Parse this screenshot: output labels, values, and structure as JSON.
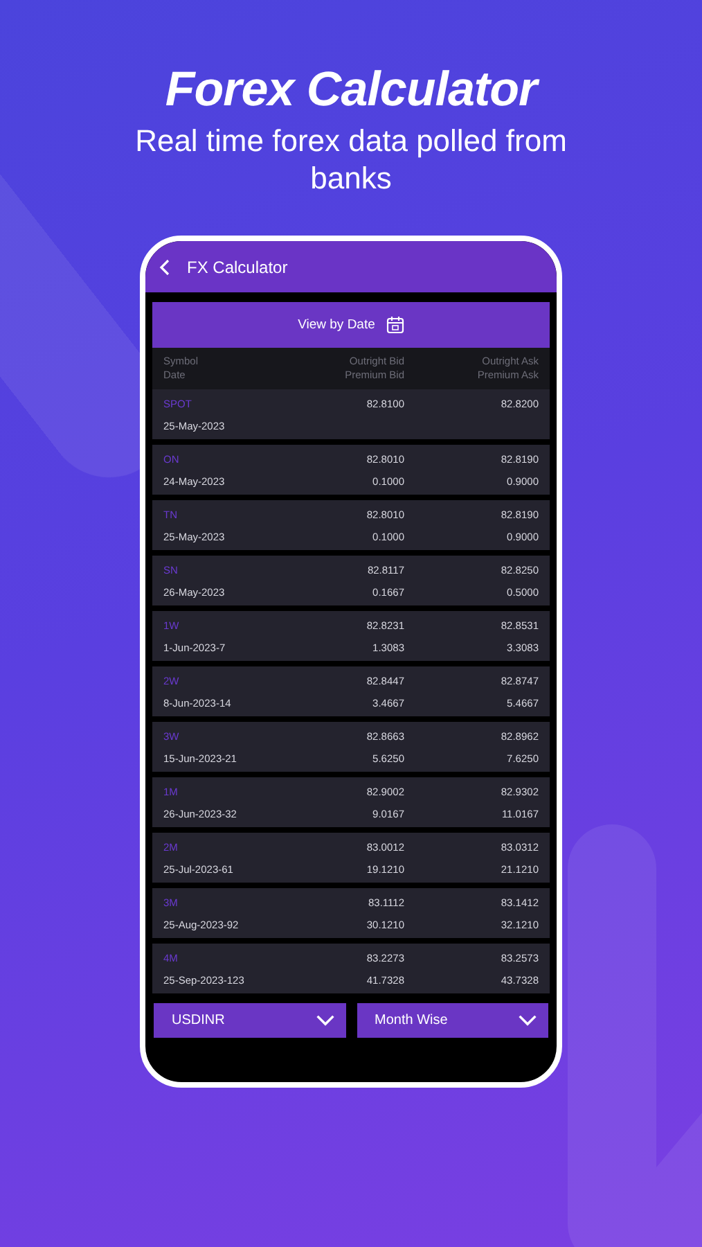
{
  "promo": {
    "headline": "Forex Calculator",
    "subtitle": "Real time forex data polled from banks"
  },
  "app_bar": {
    "title": "FX Calculator"
  },
  "view_button": {
    "label": "View by Date"
  },
  "table": {
    "columns": [
      {
        "top": "Symbol",
        "bottom": "Date"
      },
      {
        "top": "Outright Bid",
        "bottom": "Premium Bid"
      },
      {
        "top": "Outright Ask",
        "bottom": "Premium Ask"
      }
    ],
    "rows": [
      {
        "symbol": "SPOT",
        "date": "25-May-2023",
        "outright_bid": "82.8100",
        "outright_ask": "82.8200"
      },
      {
        "symbol": "ON",
        "date": "24-May-2023",
        "outright_bid": "82.8010",
        "premium_bid": "0.1000",
        "outright_ask": "82.8190",
        "premium_ask": "0.9000"
      },
      {
        "symbol": "TN",
        "date": "25-May-2023",
        "outright_bid": "82.8010",
        "premium_bid": "0.1000",
        "outright_ask": "82.8190",
        "premium_ask": "0.9000"
      },
      {
        "symbol": "SN",
        "date": "26-May-2023",
        "outright_bid": "82.8117",
        "premium_bid": "0.1667",
        "outright_ask": "82.8250",
        "premium_ask": "0.5000"
      },
      {
        "symbol": "1W",
        "date": "1-Jun-2023-7",
        "outright_bid": "82.8231",
        "premium_bid": "1.3083",
        "outright_ask": "82.8531",
        "premium_ask": "3.3083"
      },
      {
        "symbol": "2W",
        "date": "8-Jun-2023-14",
        "outright_bid": "82.8447",
        "premium_bid": "3.4667",
        "outright_ask": "82.8747",
        "premium_ask": "5.4667"
      },
      {
        "symbol": "3W",
        "date": "15-Jun-2023-21",
        "outright_bid": "82.8663",
        "premium_bid": "5.6250",
        "outright_ask": "82.8962",
        "premium_ask": "7.6250"
      },
      {
        "symbol": "1M",
        "date": "26-Jun-2023-32",
        "outright_bid": "82.9002",
        "premium_bid": "9.0167",
        "outright_ask": "82.9302",
        "premium_ask": "11.0167"
      },
      {
        "symbol": "2M",
        "date": "25-Jul-2023-61",
        "outright_bid": "83.0012",
        "premium_bid": "19.1210",
        "outright_ask": "83.0312",
        "premium_ask": "21.1210"
      },
      {
        "symbol": "3M",
        "date": "25-Aug-2023-92",
        "outright_bid": "83.1112",
        "premium_bid": "30.1210",
        "outright_ask": "83.1412",
        "premium_ask": "32.1210"
      },
      {
        "symbol": "4M",
        "date": "25-Sep-2023-123",
        "outright_bid": "83.2273",
        "premium_bid": "41.7328",
        "outright_ask": "83.2573",
        "premium_ask": "43.7328"
      }
    ]
  },
  "dropdowns": [
    {
      "value": "USDINR"
    },
    {
      "value": "Month Wise"
    }
  ]
}
